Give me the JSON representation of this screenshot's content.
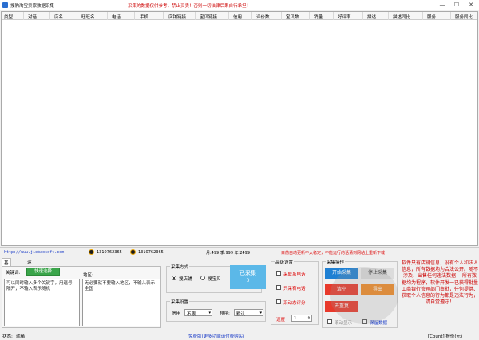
{
  "window": {
    "title": "搜豹淘宝卖家数据采集",
    "notice": "采集的数据仅供参考，禁止买卖！否则一切法律后果自行承担！",
    "minimize": "—",
    "maximize": "☐",
    "close": "✕"
  },
  "grid": {
    "columns": [
      "类型",
      "对话",
      "店名",
      "旺旺名",
      "电话",
      "手机",
      "店铺链接",
      "宝贝链接",
      "信用",
      "评价数",
      "宝贝数",
      "销量",
      "好评率",
      "描述",
      "描述同比",
      "服务",
      "服务同比"
    ]
  },
  "infobar": {
    "url": "http://www.jiebaosoft.com",
    "qq1": "1310762365",
    "qq2": "1310762365",
    "stats": "月:499 季:999 年:2499",
    "warning": "目前自动更新不太稳定，不能运行的话请到网站上重新下载"
  },
  "tabs": [
    "基本设置",
    "运行日志"
  ],
  "basic": {
    "keyword_label": "关键词:",
    "quick_select": "快速选择",
    "keyword_text": "可以同时输入多个关键字，用逗号,隔开，不输入表示随机",
    "region_label": "地区:",
    "region_text": "无必要就不要输入地区，不输入表示全国"
  },
  "collect_mode": {
    "title": "采集方式",
    "option1": "搜店铺",
    "option2": "搜宝贝",
    "collected_label": "已采集",
    "collected_count": "0"
  },
  "collect_settings": {
    "title": "采集设置",
    "credit_label": "信用",
    "credit_value": "不限",
    "sort_label": "排序:",
    "sort_value": "默认"
  },
  "advanced": {
    "title": "高级设置",
    "opt1": "采联系电话",
    "opt2": "只采有电话",
    "opt3": "采动态评分",
    "speed_label": "速度",
    "speed_value": "1"
  },
  "operations": {
    "title": "采集操作",
    "start": "开始采集",
    "stop": "停止采集",
    "clear": "清空",
    "export": "导出",
    "remove_dup": "去重复",
    "scroll_label": "滚动显示",
    "save_label": "保留数据"
  },
  "disclaimer": "软件只有店铺信息，没有个人和法人信息，所有数据均为合法公开。随不涉及、出售任何违法数据！ 所有数据均为程序，软件开发一已获得批量工商银行管理部门审批，任何提供、获取个人信息的行为都是违法行为，请自觉遵守！",
  "status": {
    "label": "状态:",
    "value": "就绪",
    "promo": "免费版(更多功能请付费购买)",
    "count": "[Count] 报价(元)"
  },
  "colors": {
    "green": "#3aa54a",
    "blue": "#1f80d3",
    "red": "#e8392b",
    "orange": "#f08a24",
    "teal": "#5bb8e8"
  }
}
